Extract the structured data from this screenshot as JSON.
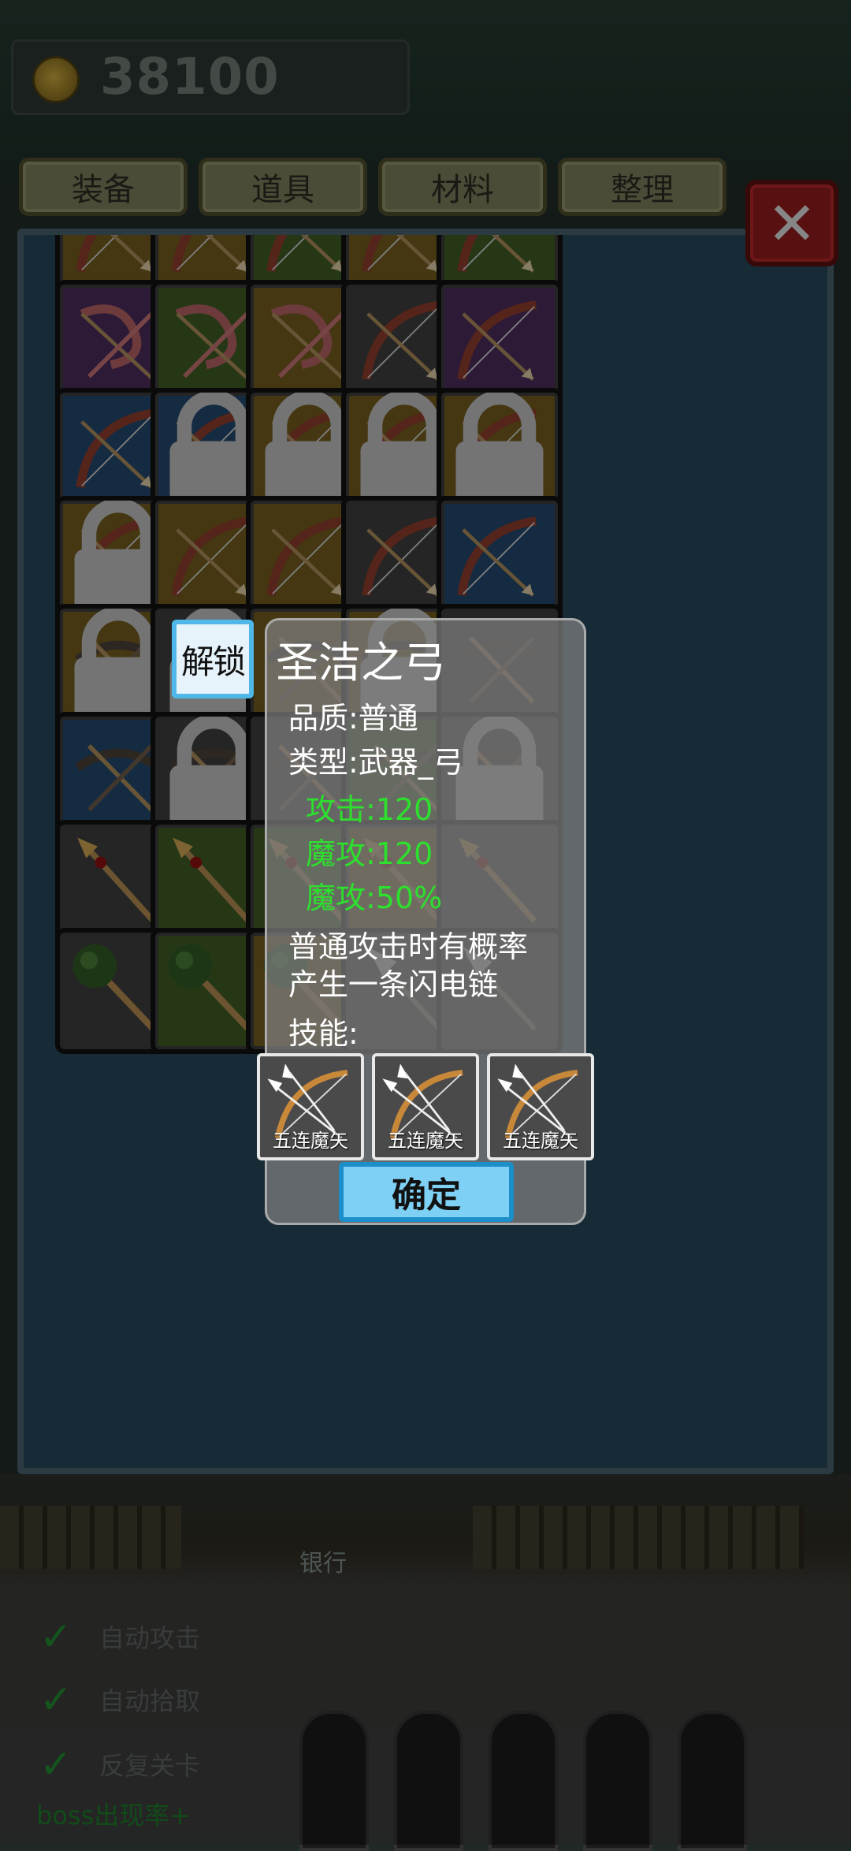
{
  "header": {
    "coin_amount": "38100"
  },
  "tabs": [
    {
      "label": "装备"
    },
    {
      "label": "道具"
    },
    {
      "label": "材料"
    },
    {
      "label": "整理"
    }
  ],
  "close_label": "✕",
  "popup": {
    "unlock_label": "解锁",
    "title": "圣洁之弓",
    "quality": "品质:普通",
    "type": "类型:武器_弓",
    "stats": [
      "攻击:120",
      "魔攻:120",
      "魔攻:50%"
    ],
    "description_lines": [
      "普通攻击时有概率",
      "产生一条闪电链"
    ],
    "skills_label": "技能:",
    "skills": [
      {
        "name": "五连魔矢"
      },
      {
        "name": "五连魔矢"
      },
      {
        "name": "五连魔矢"
      }
    ],
    "confirm_label": "确定"
  },
  "background": {
    "bank_label": "银行",
    "options": [
      {
        "label": "自动攻击"
      },
      {
        "label": "自动拾取"
      },
      {
        "label": "反复关卡"
      }
    ],
    "boss_rate_label": "boss出现率+"
  },
  "colors": {
    "panel_bg": "#26465a",
    "stat_green": "#2de02d",
    "close_red": "#8e1b1b",
    "accent_blue": "#4fb8e8",
    "rarity_purple": "#4a2a5a",
    "rarity_green": "#3e5a25",
    "rarity_gold": "#6e5a1e",
    "rarity_gray": "#3d3d3d",
    "rarity_blue": "#23466a"
  }
}
